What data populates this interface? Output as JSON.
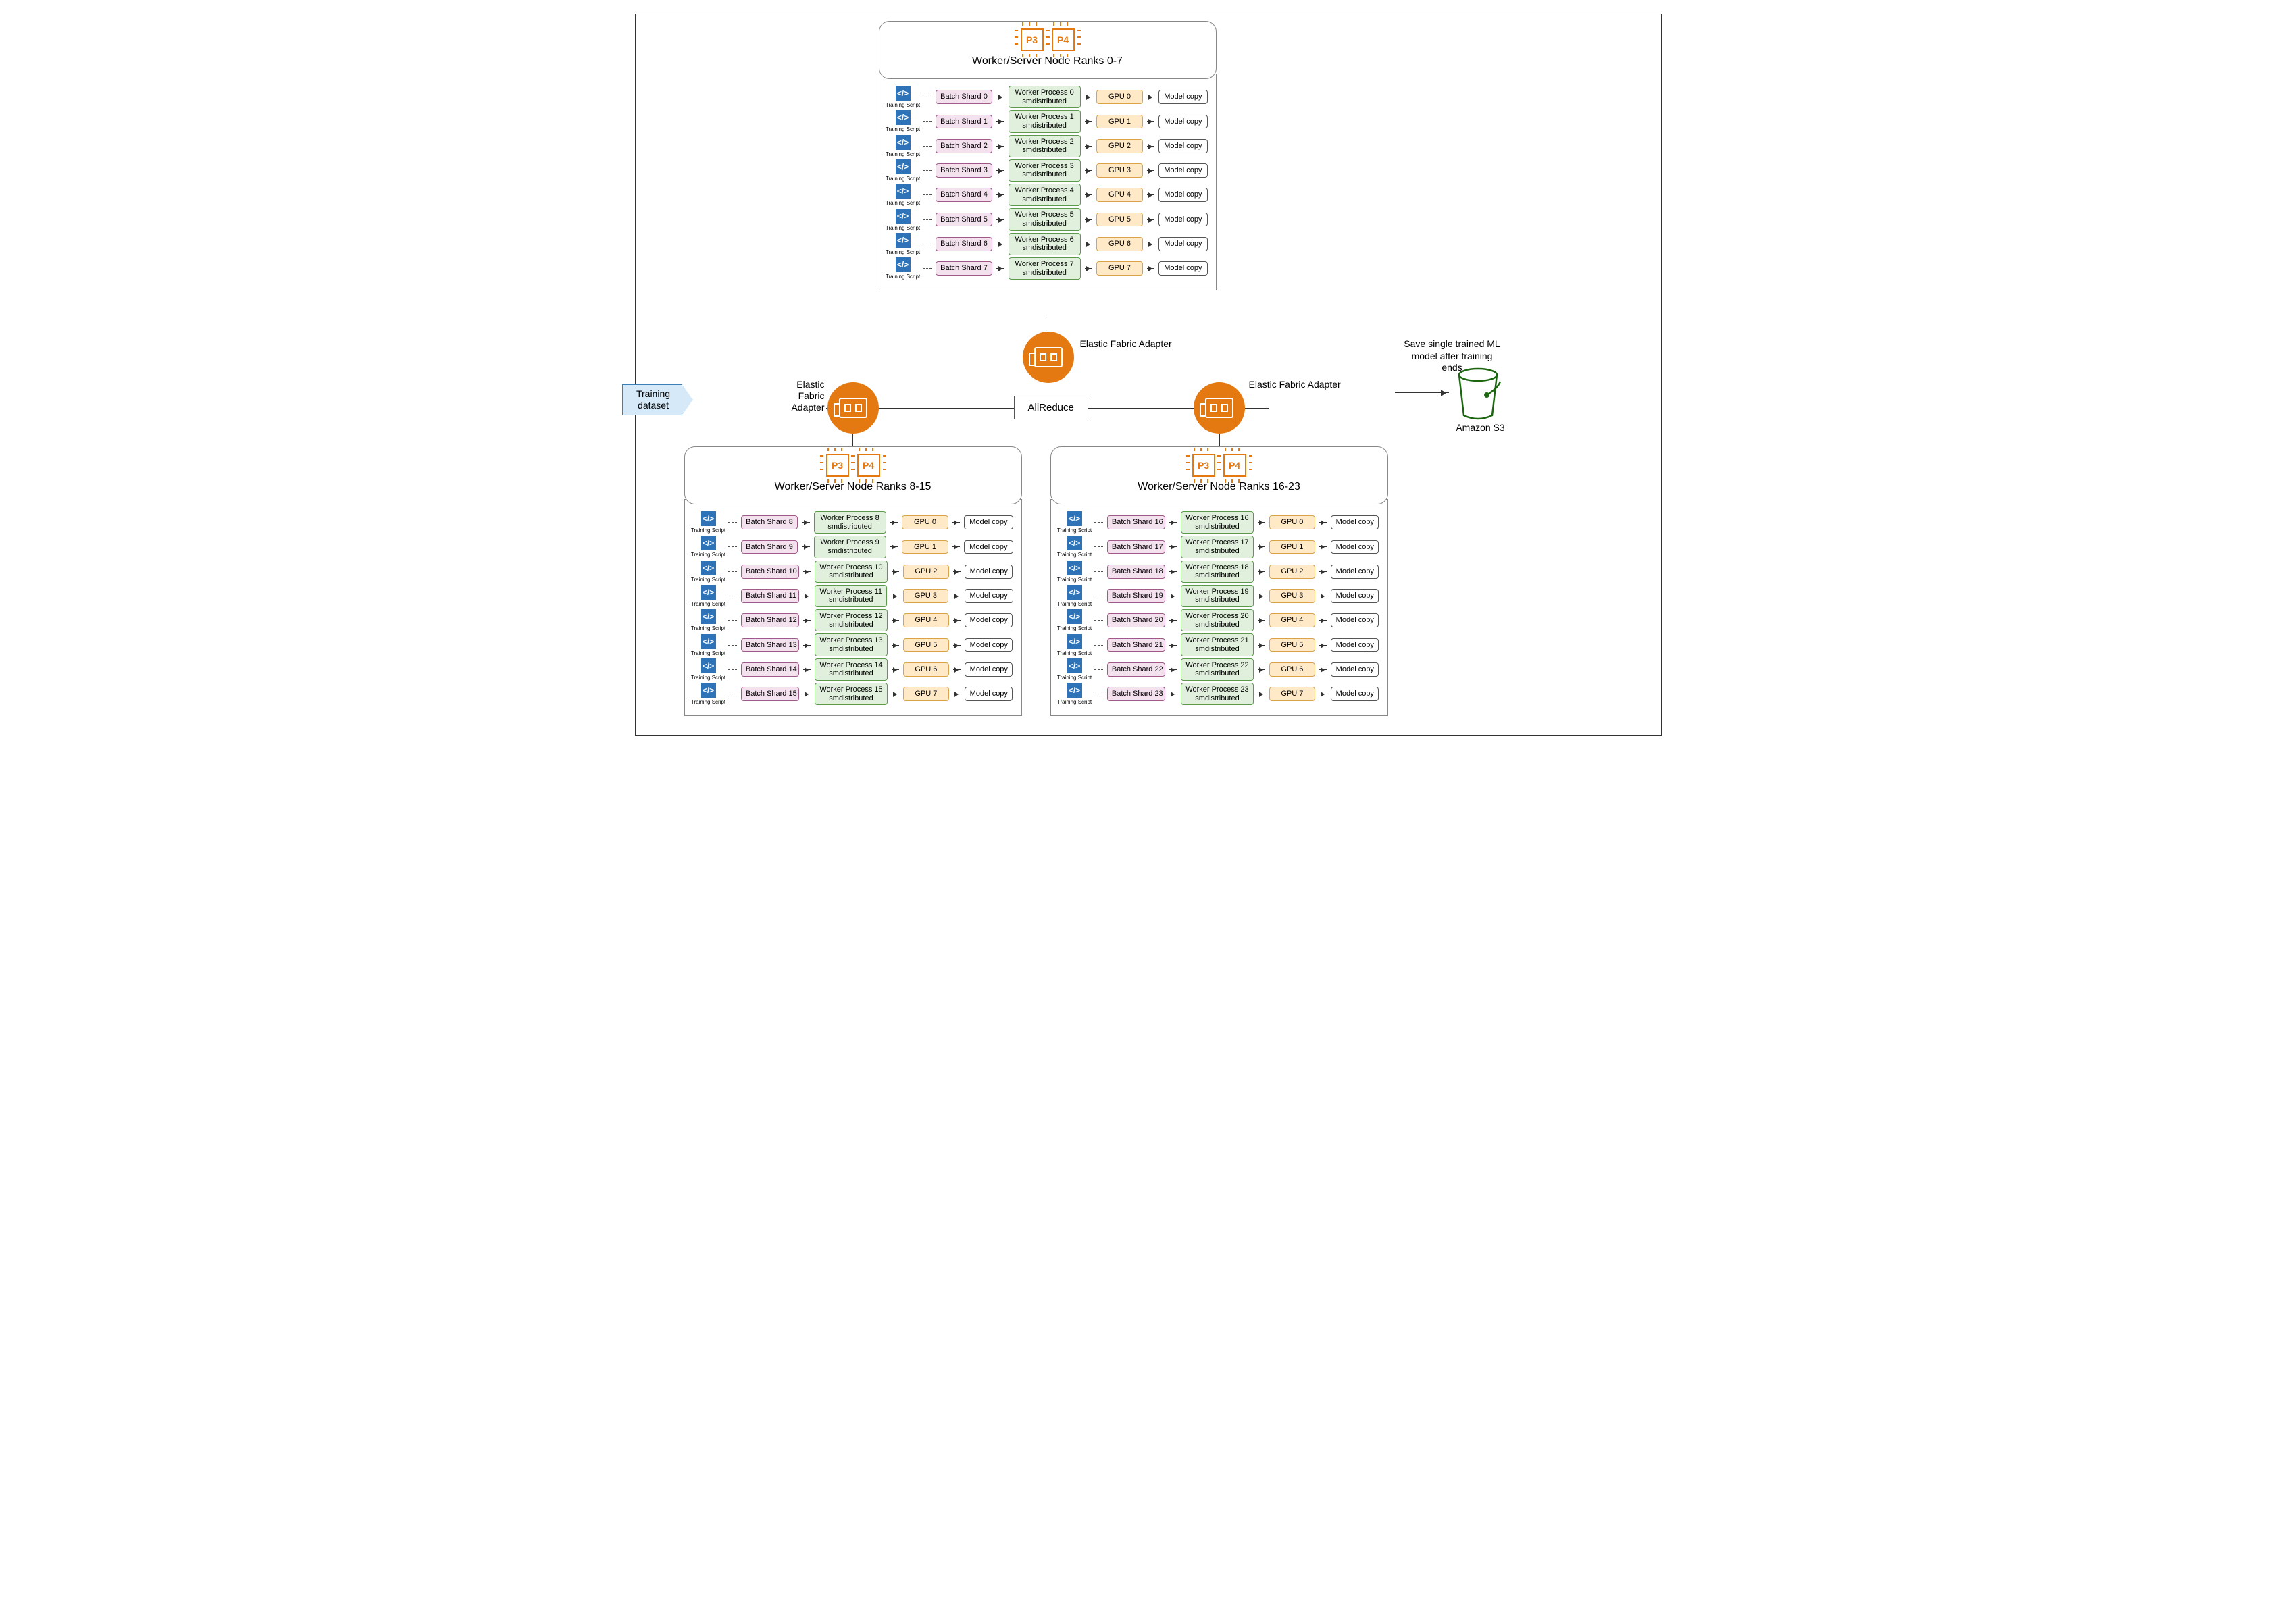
{
  "input_label": "Training dataset",
  "allreduce_label": "AllReduce",
  "efa_label": "Elastic Fabric Adapter",
  "output_text": "Save single trained ML model after training ends",
  "s3_label": "Amazon S3",
  "script_label": "Training Script",
  "chip_labels": [
    "P3",
    "P4"
  ],
  "worker_sub": "smdistributed",
  "model_copy": "Model copy",
  "nodes": [
    {
      "title": "Worker/Server Node Ranks 0-7",
      "rows": [
        {
          "shard": "Batch Shard 0",
          "worker": "Worker Process 0",
          "gpu": "GPU 0"
        },
        {
          "shard": "Batch Shard 1",
          "worker": "Worker Process 1",
          "gpu": "GPU 1"
        },
        {
          "shard": "Batch Shard 2",
          "worker": "Worker Process 2",
          "gpu": "GPU 2"
        },
        {
          "shard": "Batch Shard 3",
          "worker": "Worker Process 3",
          "gpu": "GPU 3"
        },
        {
          "shard": "Batch Shard 4",
          "worker": "Worker Process 4",
          "gpu": "GPU 4"
        },
        {
          "shard": "Batch Shard 5",
          "worker": "Worker Process 5",
          "gpu": "GPU 5"
        },
        {
          "shard": "Batch Shard 6",
          "worker": "Worker Process 6",
          "gpu": "GPU 6"
        },
        {
          "shard": "Batch Shard 7",
          "worker": "Worker Process 7",
          "gpu": "GPU 7"
        }
      ]
    },
    {
      "title": "Worker/Server Node Ranks 8-15",
      "rows": [
        {
          "shard": "Batch Shard 8",
          "worker": "Worker Process 8",
          "gpu": "GPU 0"
        },
        {
          "shard": "Batch Shard 9",
          "worker": "Worker Process 9",
          "gpu": "GPU 1"
        },
        {
          "shard": "Batch Shard 10",
          "worker": "Worker Process 10",
          "gpu": "GPU 2"
        },
        {
          "shard": "Batch Shard 11",
          "worker": "Worker Process 11",
          "gpu": "GPU 3"
        },
        {
          "shard": "Batch Shard 12",
          "worker": "Worker Process 12",
          "gpu": "GPU 4"
        },
        {
          "shard": "Batch Shard 13",
          "worker": "Worker Process 13",
          "gpu": "GPU 5"
        },
        {
          "shard": "Batch Shard 14",
          "worker": "Worker Process 14",
          "gpu": "GPU 6"
        },
        {
          "shard": "Batch Shard 15",
          "worker": "Worker Process 15",
          "gpu": "GPU 7"
        }
      ]
    },
    {
      "title": "Worker/Server Node Ranks 16-23",
      "rows": [
        {
          "shard": "Batch Shard 16",
          "worker": "Worker Process 16",
          "gpu": "GPU 0"
        },
        {
          "shard": "Batch Shard 17",
          "worker": "Worker Process 17",
          "gpu": "GPU 1"
        },
        {
          "shard": "Batch Shard 18",
          "worker": "Worker Process 18",
          "gpu": "GPU 2"
        },
        {
          "shard": "Batch Shard 19",
          "worker": "Worker Process 19",
          "gpu": "GPU 3"
        },
        {
          "shard": "Batch Shard 20",
          "worker": "Worker Process 20",
          "gpu": "GPU 4"
        },
        {
          "shard": "Batch Shard 21",
          "worker": "Worker Process 21",
          "gpu": "GPU 5"
        },
        {
          "shard": "Batch Shard 22",
          "worker": "Worker Process 22",
          "gpu": "GPU 6"
        },
        {
          "shard": "Batch Shard 23",
          "worker": "Worker Process 23",
          "gpu": "GPU 7"
        }
      ]
    }
  ]
}
